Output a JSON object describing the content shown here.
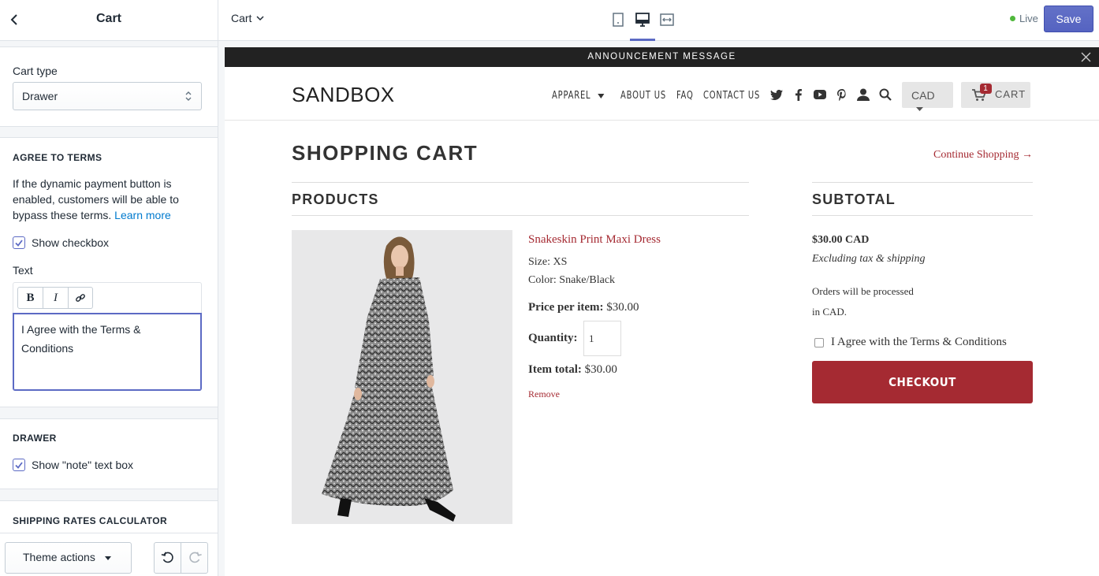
{
  "panel": {
    "title": "Cart",
    "cart_type_label": "Cart type",
    "cart_type_value": "Drawer",
    "agree_heading": "AGREE TO TERMS",
    "agree_help": "If the dynamic payment button is enabled, customers will be able to bypass these terms.",
    "agree_help_link": "Learn more",
    "show_checkbox_label": "Show checkbox",
    "show_checkbox_checked": true,
    "text_label": "Text",
    "rte_bold": "B",
    "rte_italic": "I",
    "text_value": "I Agree with the Terms & Conditions",
    "drawer_heading": "DRAWER",
    "show_note_label": "Show \"note\" text box",
    "shipping_heading": "SHIPPING RATES CALCULATOR",
    "theme_actions_label": "Theme actions"
  },
  "topbar": {
    "page_label": "Cart",
    "status_label": "Live",
    "save_label": "Save",
    "active_device": "desktop"
  },
  "preview": {
    "announcement": "ANNOUNCEMENT MESSAGE",
    "logo": "SANDBOX",
    "nav": [
      "APPAREL",
      "ABOUT US",
      "FAQ",
      "CONTACT US"
    ],
    "currency": "CAD",
    "cart_label": "CART",
    "cart_count": "1",
    "page_title": "SHOPPING CART",
    "continue_label": "Continue Shopping →",
    "products_heading": "PRODUCTS",
    "subtotal_heading": "SUBTOTAL",
    "product": {
      "name": "Snakeskin Print Maxi Dress",
      "size": "Size: XS",
      "color": "Color: Snake/Black",
      "price_label": "Price per item:",
      "price": "$30.00",
      "quantity_label": "Quantity:",
      "quantity": "1",
      "total_label": "Item total:",
      "total": "$30.00",
      "remove_label": "Remove"
    },
    "subtotal": {
      "amount": "$30.00 CAD",
      "tax_note": "Excluding tax & shipping",
      "currency_note_1": "Orders will be processed",
      "currency_note_2": "in CAD.",
      "terms_label": "I Agree with the Terms & Conditions",
      "checkout_label": "CHECKOUT"
    }
  },
  "colors": {
    "accent": "#5c6ac4",
    "brand": "#a52a32",
    "live": "#50b83c"
  }
}
